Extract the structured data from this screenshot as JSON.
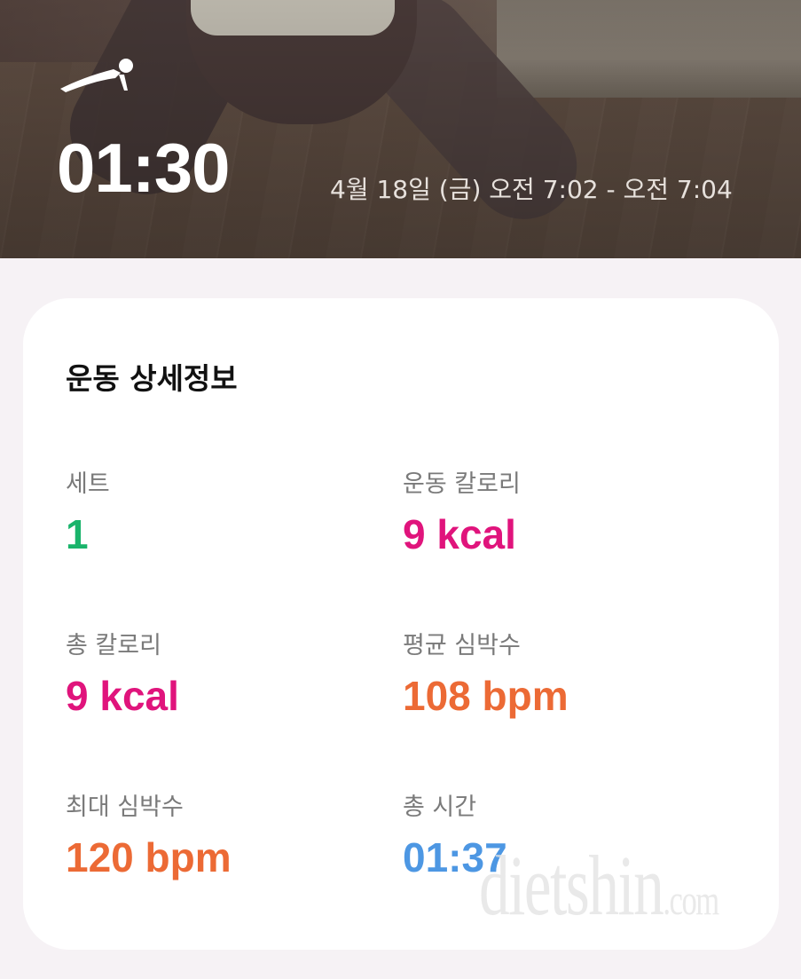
{
  "header": {
    "exercise_icon": "plank-icon",
    "timer": "01:30",
    "datetime": "4월 18일 (금) 오전 7:02 - 오전 7:04"
  },
  "details": {
    "title": "운동 상세정보",
    "stats": [
      {
        "label": "세트",
        "value": "1",
        "color": "#19b46b"
      },
      {
        "label": "운동 칼로리",
        "value": "9 kcal",
        "color": "#e0147c"
      },
      {
        "label": "총 칼로리",
        "value": "9 kcal",
        "color": "#e0147c"
      },
      {
        "label": "평균 심박수",
        "value": "108 bpm",
        "color": "#ec6a35"
      },
      {
        "label": "최대 심박수",
        "value": "120 bpm",
        "color": "#ec6a35"
      },
      {
        "label": "총 시간",
        "value": "01:37",
        "color": "#4d97e3"
      }
    ]
  },
  "watermark": {
    "text": "dietshin",
    "suffix": ".com"
  }
}
